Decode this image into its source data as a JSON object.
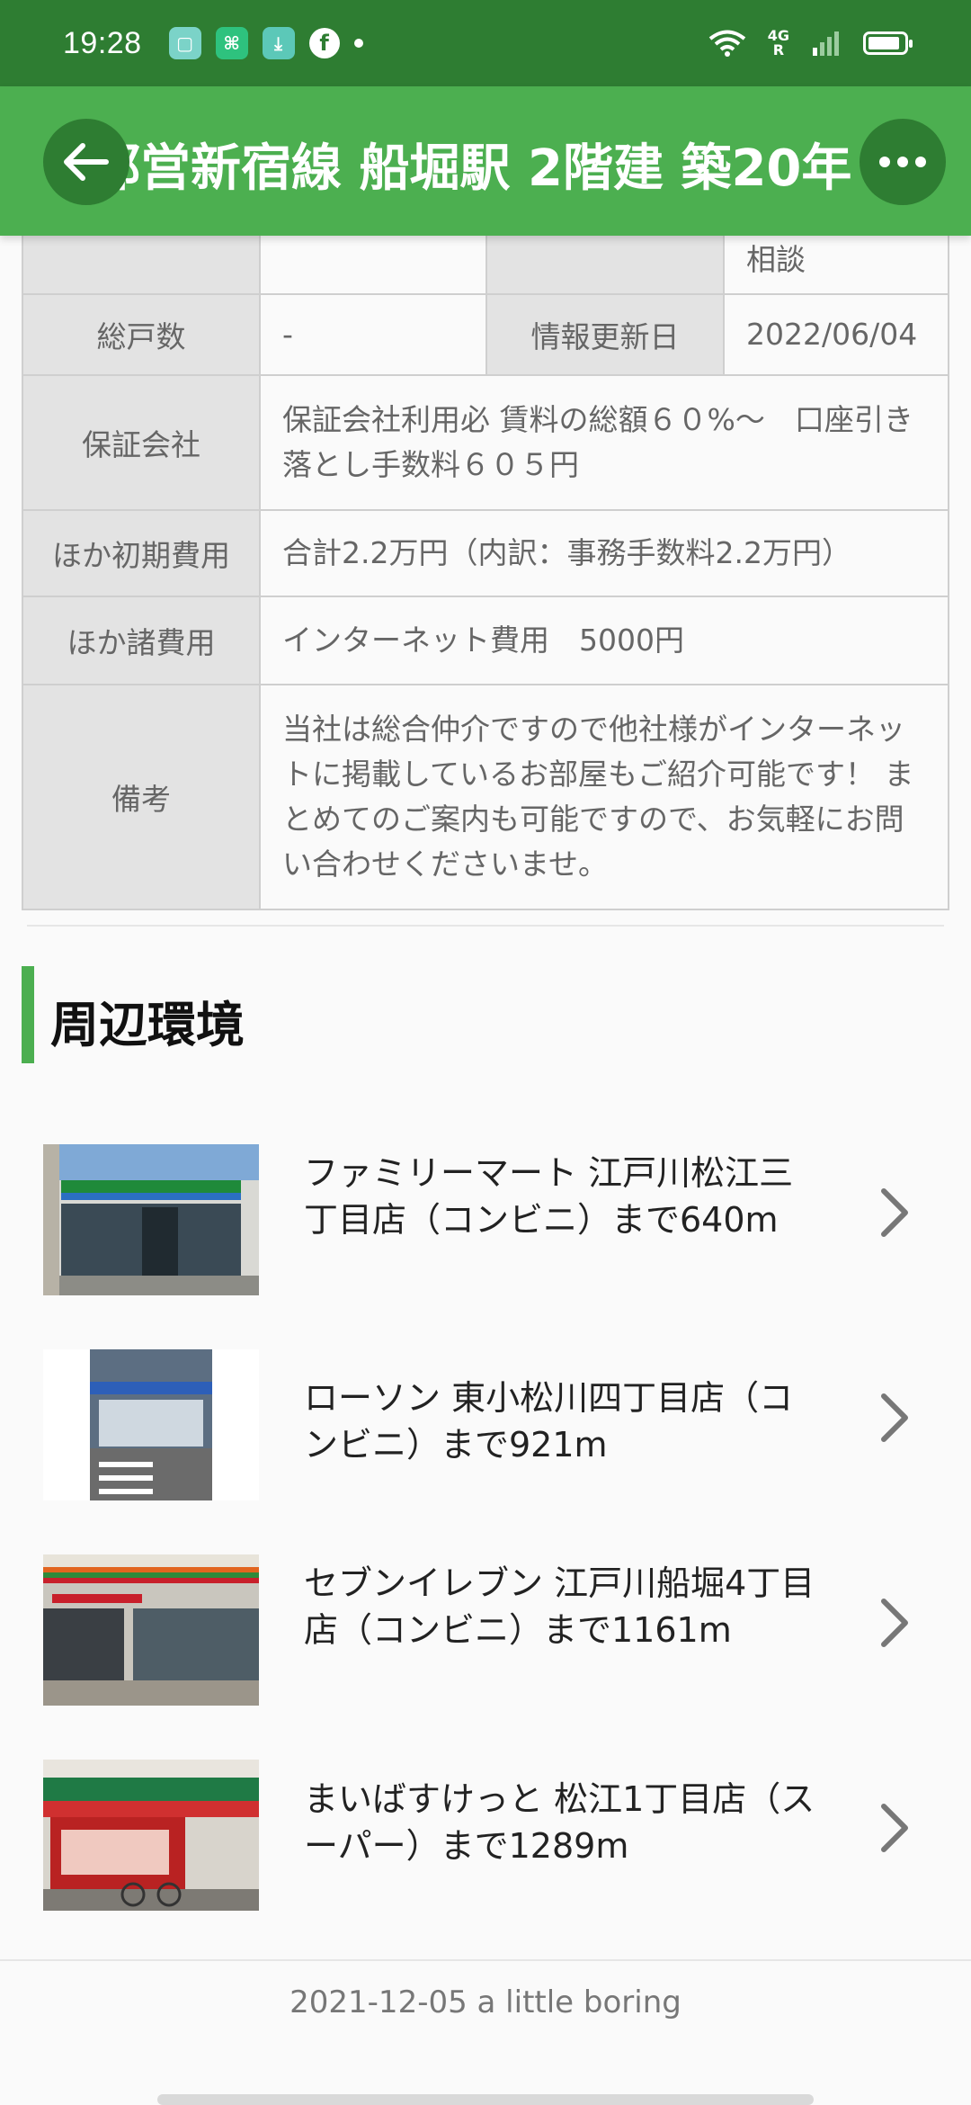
{
  "status_bar": {
    "time": "19:28",
    "network": "4G",
    "network_sub": "R",
    "apps": [
      "app-icon",
      "app-icon",
      "download-icon",
      "facebook-icon"
    ]
  },
  "app_bar": {
    "title": "都営新宿線 船堀駅 2階建 築20年",
    "back_icon": "arrow-left-icon",
    "more_icon": "more-horizontal-icon"
  },
  "spec_table": {
    "top_partial_value": "相談",
    "rows": [
      {
        "key": "総戸数",
        "value": "-",
        "key2": "情報更新日",
        "value2": "2022/06/04"
      },
      {
        "key": "保証会社",
        "value": "保証会社利用必 賃料の総額６０%～　口座引き落とし手数料６０５円"
      },
      {
        "key": "ほか初期費用",
        "value": "合計2.2万円（内訳：事務手数料2.2万円）"
      },
      {
        "key": "ほか諸費用",
        "value": "インターネット費用　5000円"
      },
      {
        "key": "備考",
        "value": "当社は総合仲介ですので他社様がインターネットに掲載しているお部屋もご紹介可能です！ まとめてのご案内も可能ですので、お気軽にお問い合わせくださいませ。"
      }
    ]
  },
  "surroundings": {
    "title": "周辺環境",
    "items": [
      {
        "label": "ファミリーマート 江戸川松江三丁目店（コンビニ）まで640m"
      },
      {
        "label": "ローソン 東小松川四丁目店（コンビニ）まで921m"
      },
      {
        "label": "セブンイレブン 江戸川船堀4丁目店（コンビニ）まで1161m"
      },
      {
        "label": "まいばすけっと 松江1丁目店（スーパー）まで1289m"
      }
    ]
  },
  "footer": {
    "text": "2021-12-05  a little boring"
  },
  "colors": {
    "primary": "#4caf50",
    "primary_dark": "#2e7d32",
    "table_key_bg": "#e3e3e3"
  }
}
